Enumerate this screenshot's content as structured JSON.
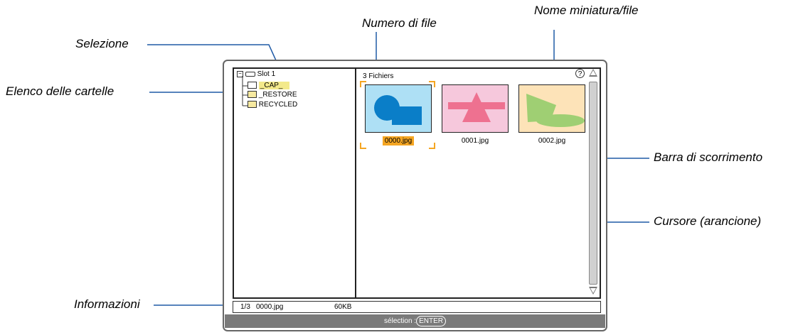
{
  "callouts": {
    "selezione": "Selezione",
    "elenco_cartelle": "Elenco delle cartelle",
    "numero_file": "Numero di file",
    "nome_miniatura": "Nome miniatura/file",
    "barra_scorrimento": "Barra di scorrimento",
    "cursore": "Cursore (arancione)",
    "informazioni": "Informazioni"
  },
  "folder_tree": {
    "root": "Slot 1",
    "items": [
      {
        "label": "_CAP_",
        "selected": true
      },
      {
        "label": "_RESTORE",
        "selected": false
      },
      {
        "label": "RECYCLED",
        "selected": false
      }
    ]
  },
  "file_pane": {
    "count": "3 Fichiers",
    "help": "?",
    "files": [
      {
        "name": "0000.jpg",
        "selected": true
      },
      {
        "name": "0001.jpg",
        "selected": false
      },
      {
        "name": "0002.jpg",
        "selected": false
      }
    ]
  },
  "info_bar": {
    "position": "1/3",
    "filename": "0000.jpg",
    "size": "60KB"
  },
  "status_bar": {
    "prefix": "sélection :",
    "key": "ENTER"
  },
  "colors": {
    "leader_line": "#1f5aa6",
    "cursor": "#f5a623",
    "selection_highlight": "#f3e98a"
  }
}
